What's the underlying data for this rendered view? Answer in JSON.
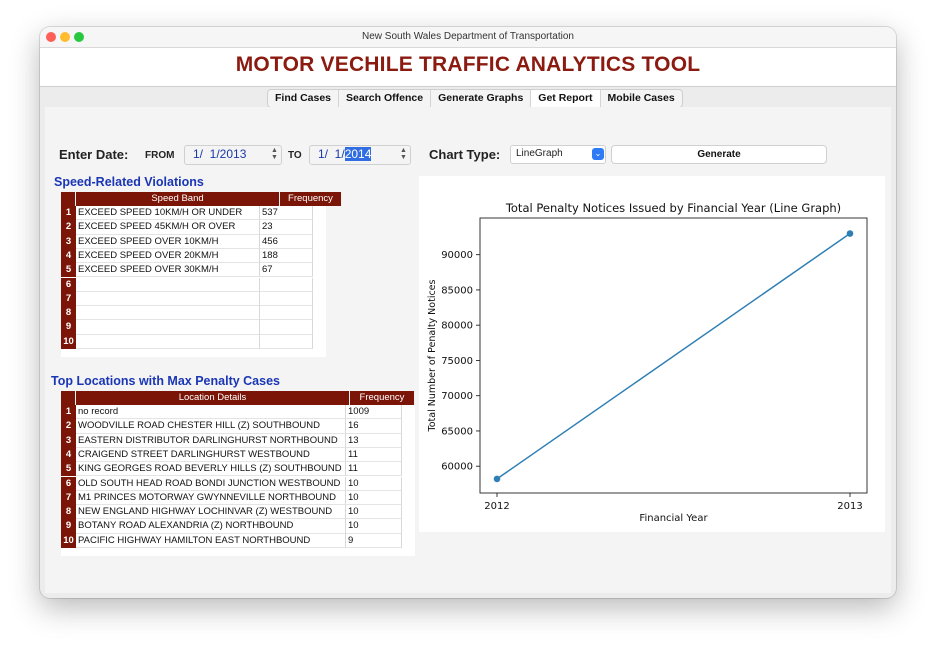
{
  "window": {
    "title": "New South Wales Department of Transportation"
  },
  "app": {
    "title": "MOTOR VECHILE TRAFFIC ANALYTICS TOOL"
  },
  "tabs": [
    {
      "label": "Find Cases"
    },
    {
      "label": "Search Offence"
    },
    {
      "label": "Generate Graphs"
    },
    {
      "label": "Get Report",
      "active": true
    },
    {
      "label": "Mobile Cases"
    }
  ],
  "date_filter": {
    "label": "Enter Date:",
    "from_label": "FROM",
    "from_value": "1/  1/2013",
    "to_label": "TO",
    "to_value_prefix": "1/  1/",
    "to_value_selected": "2014"
  },
  "chart_controls": {
    "label": "Chart Type:",
    "selected": "LineGraph",
    "generate_label": "Generate"
  },
  "speed_section": {
    "title": "Speed-Related Violations",
    "columns": [
      "Speed Band",
      "Frequency"
    ],
    "rows": [
      {
        "n": "1",
        "band": "EXCEED SPEED 10KM/H OR UNDER",
        "freq": "537"
      },
      {
        "n": "2",
        "band": "EXCEED SPEED 45KM/H OR OVER",
        "freq": "23"
      },
      {
        "n": "3",
        "band": "EXCEED SPEED OVER 10KM/H",
        "freq": "456"
      },
      {
        "n": "4",
        "band": "EXCEED SPEED OVER 20KM/H",
        "freq": "188"
      },
      {
        "n": "5",
        "band": "EXCEED SPEED OVER 30KM/H",
        "freq": "67"
      },
      {
        "n": "6",
        "band": "",
        "freq": ""
      },
      {
        "n": "7",
        "band": "",
        "freq": ""
      },
      {
        "n": "8",
        "band": "",
        "freq": ""
      },
      {
        "n": "9",
        "band": "",
        "freq": ""
      },
      {
        "n": "10",
        "band": "",
        "freq": ""
      }
    ]
  },
  "location_section": {
    "title": "Top Locations with Max Penalty Cases",
    "columns": [
      "Location Details",
      "Frequency"
    ],
    "rows": [
      {
        "n": "1",
        "loc": "no record",
        "freq": "1009"
      },
      {
        "n": "2",
        "loc": "WOODVILLE ROAD CHESTER HILL (Z) SOUTHBOUND",
        "freq": "16"
      },
      {
        "n": "3",
        "loc": "EASTERN DISTRIBUTOR DARLINGHURST NORTHBOUND",
        "freq": "13"
      },
      {
        "n": "4",
        "loc": "CRAIGEND STREET DARLINGHURST WESTBOUND",
        "freq": "11"
      },
      {
        "n": "5",
        "loc": "KING GEORGES ROAD BEVERLY HILLS (Z) SOUTHBOUND",
        "freq": "11"
      },
      {
        "n": "6",
        "loc": "OLD SOUTH HEAD ROAD BONDI JUNCTION WESTBOUND",
        "freq": "10"
      },
      {
        "n": "7",
        "loc": "M1 PRINCES MOTORWAY GWYNNEVILLE NORTHBOUND",
        "freq": "10"
      },
      {
        "n": "8",
        "loc": "NEW ENGLAND HIGHWAY LOCHINVAR (Z) WESTBOUND",
        "freq": "10"
      },
      {
        "n": "9",
        "loc": "BOTANY ROAD ALEXANDRIA (Z) NORTHBOUND",
        "freq": "10"
      },
      {
        "n": "10",
        "loc": "PACIFIC HIGHWAY HAMILTON EAST NORTHBOUND",
        "freq": "9"
      }
    ]
  },
  "chart_data": {
    "type": "line",
    "title": "Total Penalty Notices Issued by Financial Year (Line Graph)",
    "xlabel": "Financial Year",
    "ylabel": "Total Number of Penalty Notices",
    "x": [
      "2012",
      "2013"
    ],
    "series": [
      {
        "values": [
          58200,
          93000
        ]
      }
    ],
    "ylim": [
      56200,
      95200
    ],
    "yticks": [
      60000,
      65000,
      70000,
      75000,
      80000,
      85000,
      90000
    ],
    "grid": false,
    "line_color": "#2f7fb5"
  }
}
